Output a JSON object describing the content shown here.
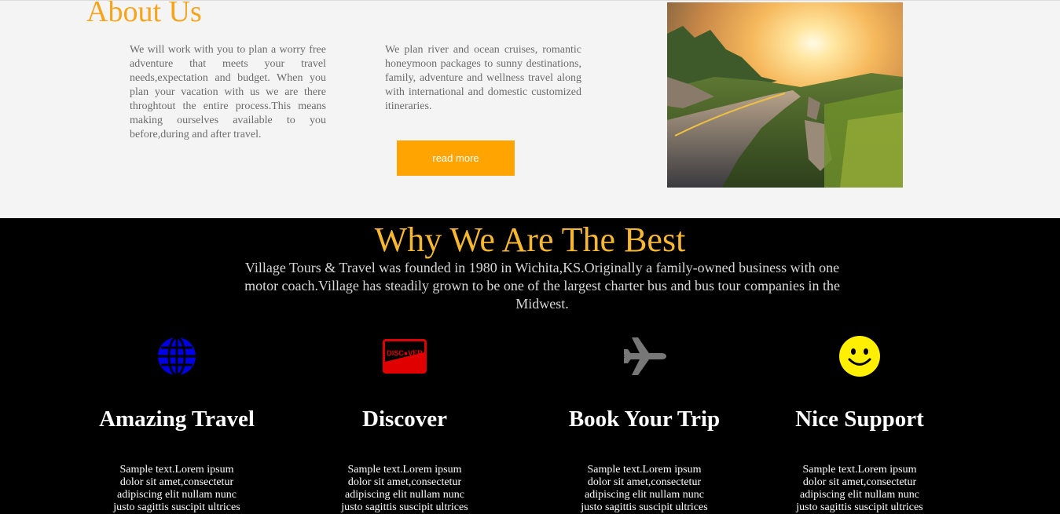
{
  "about": {
    "title": "About Us",
    "col1": "We will work with you to plan a worry free adventure that meets your travel needs,expectation and budget. When you plan your vacation with us we are there throghtout the entire process.This means making ourselves available to you before,during and after travel.",
    "col2": "We plan river and ocean cruises, romantic honeymoon packages to sunny destinations, family, adventure and wellness travel along with international and domestic customized itineraries.",
    "read_more_label": "read more",
    "colors": {
      "title": "#f5a41b",
      "button": "#ffa400"
    }
  },
  "best": {
    "title": "Why We Are The Best",
    "intro": "Village Tours & Travel was founded in 1980 in Wichita,KS.Originally a family-owned business with one motor coach.Village has steadily grown to be one of the largest charter bus and bus tour companies in the Midwest.",
    "features": [
      {
        "icon": "globe-icon",
        "title": "Amazing Travel",
        "text": "Sample text.Lorem ipsum dolor sit amet,consectetur adipiscing elit nullam nunc justo sagittis suscipit ultrices"
      },
      {
        "icon": "discover-card-icon",
        "title": "Discover",
        "text": "Sample text.Lorem ipsum dolor sit amet,consectetur adipiscing elit nullam nunc justo sagittis suscipit ultrices"
      },
      {
        "icon": "airplane-icon",
        "title": "Book Your Trip",
        "text": "Sample text.Lorem ipsum dolor sit amet,consectetur adipiscing elit nullam nunc justo sagittis suscipit ultrices"
      },
      {
        "icon": "smiley-icon",
        "title": "Nice Support",
        "text": "Sample text.Lorem ipsum dolor sit amet,consectetur adipiscing elit nullam nunc justo sagittis suscipit ultrices"
      }
    ],
    "colors": {
      "title": "#f7b830",
      "globe": "#0000e6",
      "discover": "#e00000",
      "plane": "#777777",
      "smiley": "#ffef00"
    }
  }
}
